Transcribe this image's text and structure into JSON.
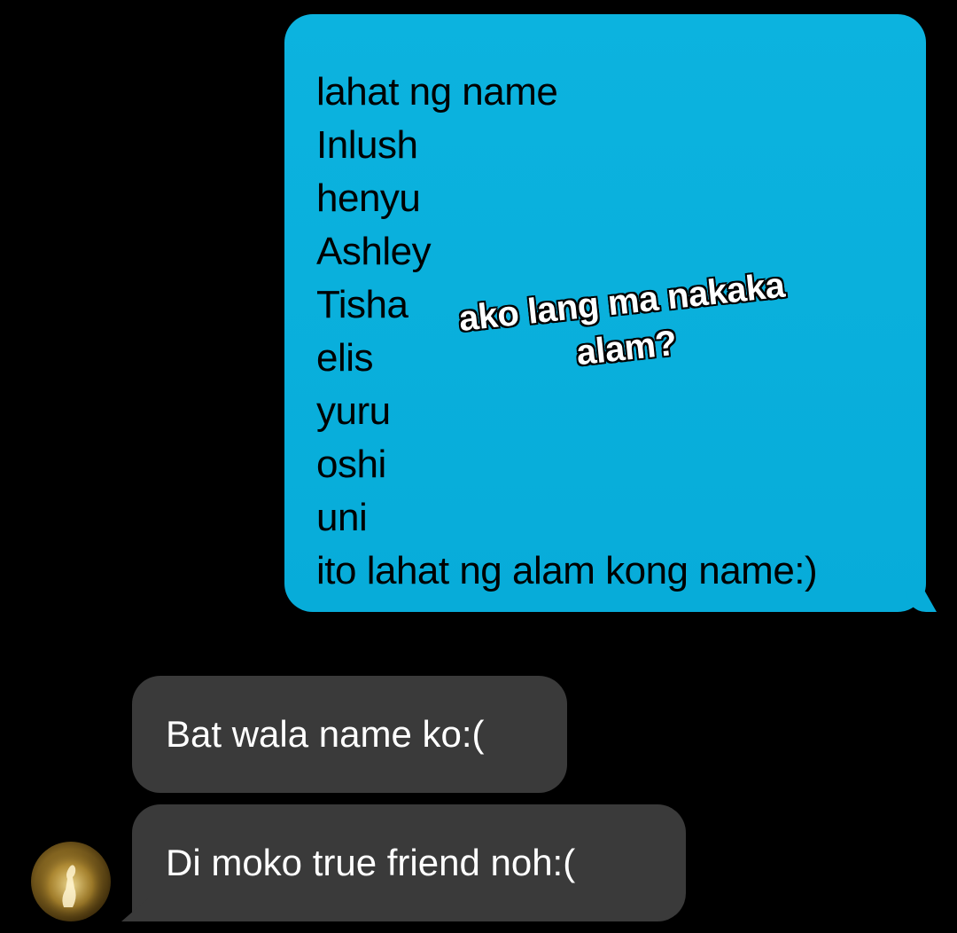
{
  "conversation": {
    "outgoing_message": {
      "lines": [
        "lahat ng name",
        "Inlush",
        "henyu",
        "Ashley",
        "Tisha",
        "elis",
        "yuru",
        "oshi",
        "uni",
        "ito lahat ng alam kong name:)"
      ],
      "bubble_color": "#0ab0dc"
    },
    "overlay_caption": {
      "line1": "ako lang ma nakaka",
      "line2": "alam?"
    },
    "incoming_messages": [
      {
        "text": "Bat wala name ko:("
      },
      {
        "text": "Di moko true friend noh:("
      }
    ],
    "incoming_bubble_color": "#3a3a3a",
    "avatar_icon": "user-avatar-icon"
  }
}
